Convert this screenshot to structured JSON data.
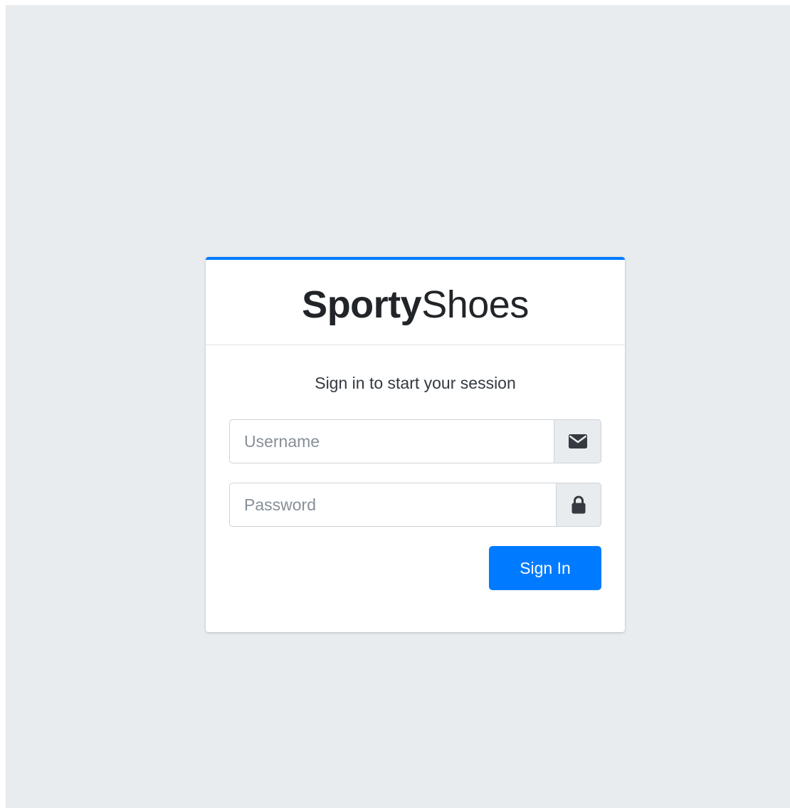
{
  "brand": {
    "bold": "Sporty",
    "light": "Shoes"
  },
  "login": {
    "message": "Sign in to start your session",
    "username_placeholder": "Username",
    "password_placeholder": "Password",
    "submit_label": "Sign In",
    "username_icon": "envelope-icon",
    "password_icon": "lock-icon"
  },
  "colors": {
    "accent": "#007bff",
    "page_background": "#e9ecef",
    "card_background": "#ffffff"
  }
}
